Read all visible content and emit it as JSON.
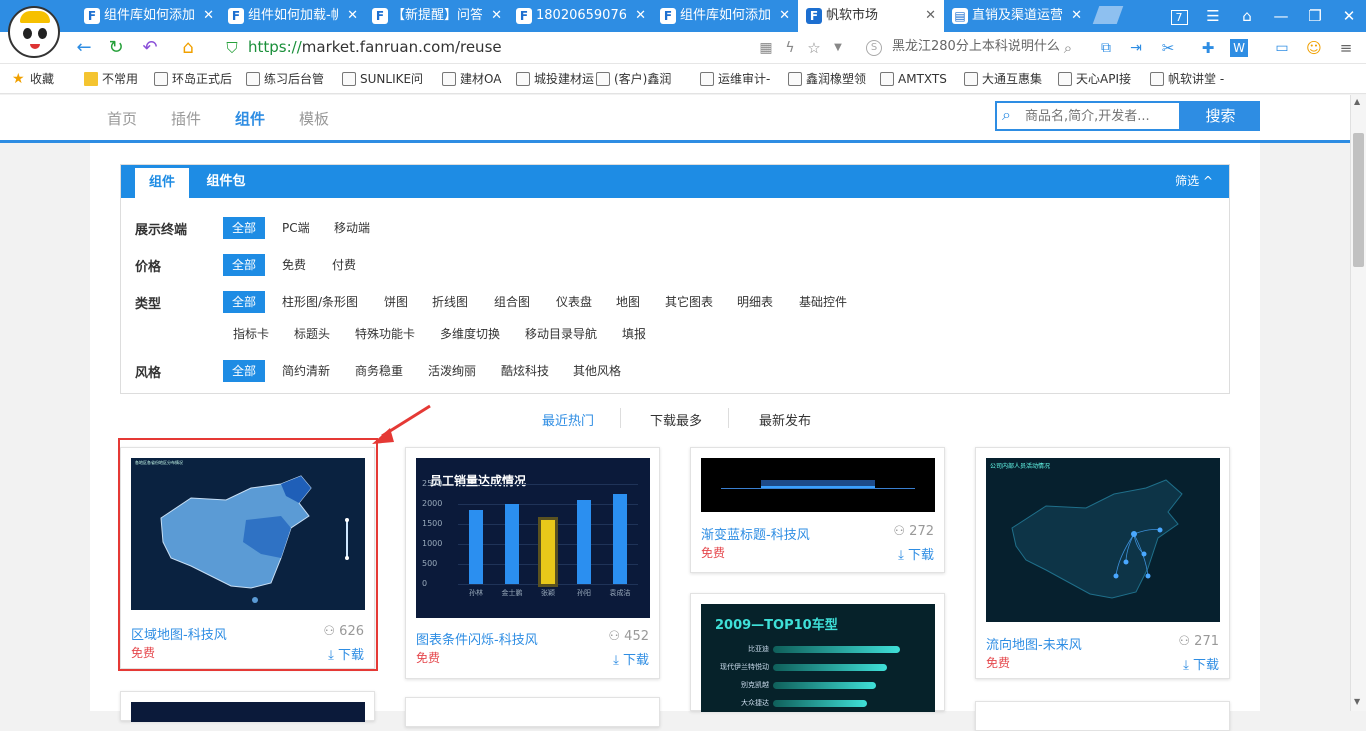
{
  "browser": {
    "tabs": [
      {
        "label": "组件库如何添加",
        "icon": "F"
      },
      {
        "label": "组件如何加载-帆",
        "icon": "F"
      },
      {
        "label": "【新提醒】问答",
        "icon": "F"
      },
      {
        "label": "18020659076 -",
        "icon": "F"
      },
      {
        "label": "组件库如何添加",
        "icon": "F"
      },
      {
        "label": "帆软市场",
        "icon": "F"
      },
      {
        "label": "直销及渠道运营",
        "icon": "▤"
      }
    ],
    "tab_count": "7",
    "url_scheme": "https://",
    "url_rest": "market.fanruan.com/reuse",
    "address_search_text": "黑龙江280分上本科说明什么",
    "bookmarks": [
      "收藏",
      "不常用",
      "环岛正式后",
      "练习后台管",
      "SUNLIKE问",
      "建材OA",
      "城投建材运",
      "(客户)鑫润",
      "运维审计-",
      "鑫润橡塑领",
      "AMTXTS",
      "大通互惠集",
      "天心API接",
      "帆软讲堂 -"
    ]
  },
  "site_nav": {
    "items": [
      "首页",
      "插件",
      "组件",
      "模板"
    ],
    "active_index": 2,
    "search_placeholder": "商品名,简介,开发者...",
    "search_button": "搜索"
  },
  "filter": {
    "tabs": [
      "组件",
      "组件包"
    ],
    "toggle_label": "筛选",
    "rows": [
      {
        "label": "展示终端",
        "options": [
          "全部",
          "PC端",
          "移动端"
        ]
      },
      {
        "label": "价格",
        "options": [
          "全部",
          "免费",
          "付费"
        ]
      },
      {
        "label": "类型",
        "options": [
          "全部",
          "柱形图/条形图",
          "饼图",
          "折线图",
          "组合图",
          "仪表盘",
          "地图",
          "其它图表",
          "明细表",
          "基础控件"
        ],
        "options2": [
          "指标卡",
          "标题头",
          "特殊功能卡",
          "多维度切换",
          "移动目录导航",
          "填报"
        ]
      },
      {
        "label": "风格",
        "options": [
          "全部",
          "简约清新",
          "商务稳重",
          "活泼绚丽",
          "酷炫科技",
          "其他风格"
        ]
      }
    ]
  },
  "sort": [
    "最近热门",
    "下载最多",
    "最新发布"
  ],
  "cards": [
    {
      "title": "区域地图-科技风",
      "price": "免费",
      "count": "626",
      "download": "下载",
      "thumb_caption": "各地区各省份地区分布情况"
    },
    {
      "title": "图表条件闪烁-科技风",
      "price": "免费",
      "count": "452",
      "download": "下载",
      "thumb_caption": "员工销量达成情况"
    },
    {
      "title": "渐变蓝标题-科技风",
      "price": "免费",
      "count": "272",
      "download": "下载",
      "thumb_caption": ""
    },
    {
      "title": "流向地图-未来风",
      "price": "免费",
      "count": "271",
      "download": "下载",
      "thumb_caption": "公司内部人员活动情况"
    },
    {
      "title": "",
      "price": "",
      "count": "",
      "download": "",
      "thumb_caption": "2009—TOP10车型"
    }
  ],
  "bar_chart": {
    "yticks": [
      "2500",
      "2000",
      "1500",
      "1000",
      "500",
      "0"
    ],
    "categories": [
      "孙林",
      "金士鹏",
      "张颖",
      "孙阳",
      "袁成洁"
    ],
    "values": [
      1850,
      2000,
      1600,
      2100,
      2250
    ],
    "ymax": 2500
  },
  "top10_chart": {
    "labels": [
      "比亚迪",
      "现代伊兰特悦动",
      "别克凯越",
      "大众捷达"
    ],
    "values": [
      0.95,
      0.85,
      0.77,
      0.7
    ]
  }
}
